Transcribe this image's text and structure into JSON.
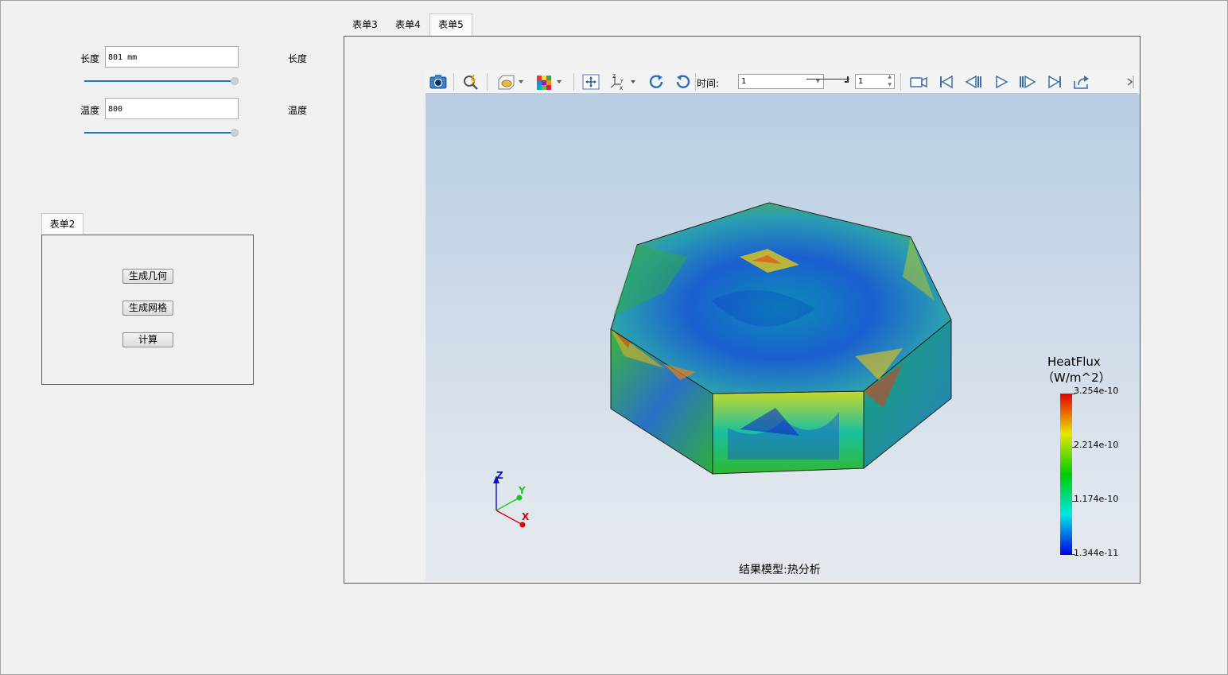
{
  "left_form": {
    "length_label": "长度",
    "length_value": "801 mm",
    "length_side_label": "长度",
    "length_slider_value": 1.0,
    "temperature_label": "温度",
    "temperature_value": "800",
    "temperature_side_label": "温度",
    "temperature_slider_value": 1.0
  },
  "form2": {
    "tab_label": "表单2",
    "buttons": {
      "generate_geometry": "生成几何",
      "generate_mesh": "生成网格",
      "compute": "计算"
    }
  },
  "main_tabs": [
    {
      "label": "表单3",
      "active": false
    },
    {
      "label": "表单4",
      "active": false
    },
    {
      "label": "表单5",
      "active": true
    }
  ],
  "toolbar": {
    "icons": [
      "camera-icon",
      "zoom-query-icon",
      "display-mode-icon",
      "color-cube-icon",
      "fit-view-icon",
      "axes-orientation-icon",
      "rotate-cw-icon",
      "rotate-ccw-icon"
    ],
    "time_label": "时间:",
    "time_combo_value": "1",
    "time_spin_value": "1",
    "playback_icons": [
      "record-video-icon",
      "first-frame-icon",
      "previous-frame-icon",
      "play-icon",
      "next-frame-icon",
      "last-frame-icon",
      "export-icon"
    ]
  },
  "viewport": {
    "legend": {
      "title": "HeatFlux",
      "unit": "（W/m^2）",
      "ticks": [
        "3.254e-10",
        "2.214e-10",
        "1.174e-10",
        "1.344e-11"
      ],
      "colors": [
        "#e60000",
        "#e6e600",
        "#00cc00",
        "#00e6e6",
        "#0000e6"
      ]
    },
    "axes": {
      "x": "X",
      "y": "Y",
      "z": "Z",
      "x_color": "#e00000",
      "y_color": "#22c322",
      "z_color": "#1010c8"
    },
    "caption": "结果模型:热分析"
  }
}
